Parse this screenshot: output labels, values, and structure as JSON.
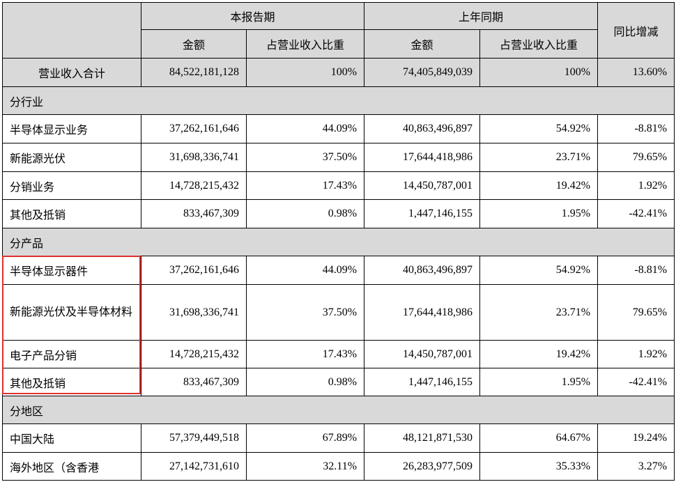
{
  "header": {
    "current_period": "本报告期",
    "prior_period": "上年同期",
    "yoy_change": "同比增减",
    "amount": "金额",
    "share_of_revenue": "占营业收入比重"
  },
  "total_row": {
    "label": "营业收入合计",
    "cur_amount": "84,522,181,128",
    "cur_pct": "100%",
    "prior_amount": "74,405,849,039",
    "prior_pct": "100%",
    "yoy": "13.60%"
  },
  "sections": [
    {
      "title": "分行业",
      "rows": [
        {
          "label": "半导体显示业务",
          "cur_amount": "37,262,161,646",
          "cur_pct": "44.09%",
          "prior_amount": "40,863,496,897",
          "prior_pct": "54.92%",
          "yoy": "-8.81%"
        },
        {
          "label": "新能源光伏",
          "cur_amount": "31,698,336,741",
          "cur_pct": "37.50%",
          "prior_amount": "17,644,418,986",
          "prior_pct": "23.71%",
          "yoy": "79.65%"
        },
        {
          "label": "分销业务",
          "cur_amount": "14,728,215,432",
          "cur_pct": "17.43%",
          "prior_amount": "14,450,787,001",
          "prior_pct": "19.42%",
          "yoy": "1.92%"
        },
        {
          "label": "其他及抵销",
          "cur_amount": "833,467,309",
          "cur_pct": "0.98%",
          "prior_amount": "1,447,146,155",
          "prior_pct": "1.95%",
          "yoy": "-42.41%"
        }
      ]
    },
    {
      "title": "分产品",
      "rows": [
        {
          "label": "半导体显示器件",
          "cur_amount": "37,262,161,646",
          "cur_pct": "44.09%",
          "prior_amount": "40,863,496,897",
          "prior_pct": "54.92%",
          "yoy": "-8.81%"
        },
        {
          "label": "新能源光伏及半导体材料",
          "cur_amount": "31,698,336,741",
          "cur_pct": "37.50%",
          "prior_amount": "17,644,418,986",
          "prior_pct": "23.71%",
          "yoy": "79.65%"
        },
        {
          "label": "电子产品分销",
          "cur_amount": "14,728,215,432",
          "cur_pct": "17.43%",
          "prior_amount": "14,450,787,001",
          "prior_pct": "19.42%",
          "yoy": "1.92%"
        },
        {
          "label": "其他及抵销",
          "cur_amount": "833,467,309",
          "cur_pct": "0.98%",
          "prior_amount": "1,447,146,155",
          "prior_pct": "1.95%",
          "yoy": "-42.41%"
        }
      ]
    },
    {
      "title": "分地区",
      "rows": [
        {
          "label": "中国大陆",
          "cur_amount": "57,379,449,518",
          "cur_pct": "67.89%",
          "prior_amount": "48,121,871,530",
          "prior_pct": "64.67%",
          "yoy": "19.24%"
        },
        {
          "label": "海外地区（含香港",
          "cur_amount": "27,142,731,610",
          "cur_pct": "32.11%",
          "prior_amount": "26,283,977,509",
          "prior_pct": "35.33%",
          "yoy": "3.27%"
        }
      ]
    }
  ],
  "highlight_color": "#e0302e"
}
